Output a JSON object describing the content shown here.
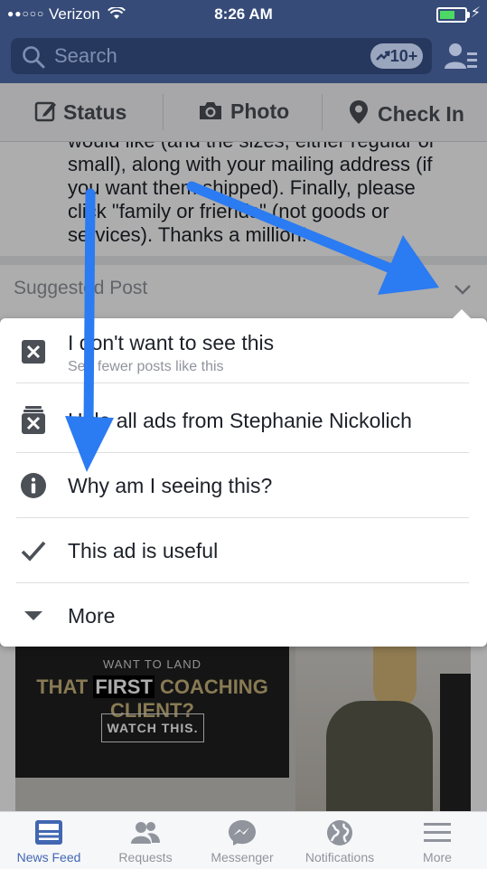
{
  "status_bar": {
    "carrier": "Verizon",
    "time": "8:26 AM"
  },
  "header": {
    "search_placeholder": "Search",
    "trending_badge": "10+"
  },
  "composer": {
    "status": "Status",
    "photo": "Photo",
    "check_in": "Check In"
  },
  "post": {
    "text": "would like (and the sizes, either regular or small), along with your mailing address (if you want them shipped). Finally, please click \"family or friends\" (not goods or services). Thanks a million!",
    "label": "Suggested Post"
  },
  "menu": {
    "items": [
      {
        "title": "I don't want to see this",
        "subtitle": "See fewer posts like this",
        "icon": "x-box-icon"
      },
      {
        "title": "Hide all ads from Stephanie Nickolich",
        "icon": "stack-x-icon"
      },
      {
        "title": "Why am I seeing this?",
        "icon": "info-icon"
      },
      {
        "title": "This ad is useful",
        "icon": "checkmark-icon"
      },
      {
        "title": "More",
        "icon": "triangle-down-icon"
      }
    ]
  },
  "ad": {
    "line1": "WANT TO LAND",
    "line2_pre": "THAT",
    "line2_highlight": "FIRST",
    "line2_post": "COACHING CLIENT?",
    "button": "WATCH THIS."
  },
  "tabs": [
    {
      "label": "News Feed",
      "icon": "news-feed-icon",
      "active": true
    },
    {
      "label": "Requests",
      "icon": "requests-icon",
      "active": false
    },
    {
      "label": "Messenger",
      "icon": "messenger-icon",
      "active": false
    },
    {
      "label": "Notifications",
      "icon": "globe-icon",
      "active": false
    },
    {
      "label": "More",
      "icon": "menu-icon",
      "active": false
    }
  ],
  "colors": {
    "header_blue": "#364b78",
    "accent": "#4267b2",
    "annotation_arrow": "#2b7bf2"
  }
}
